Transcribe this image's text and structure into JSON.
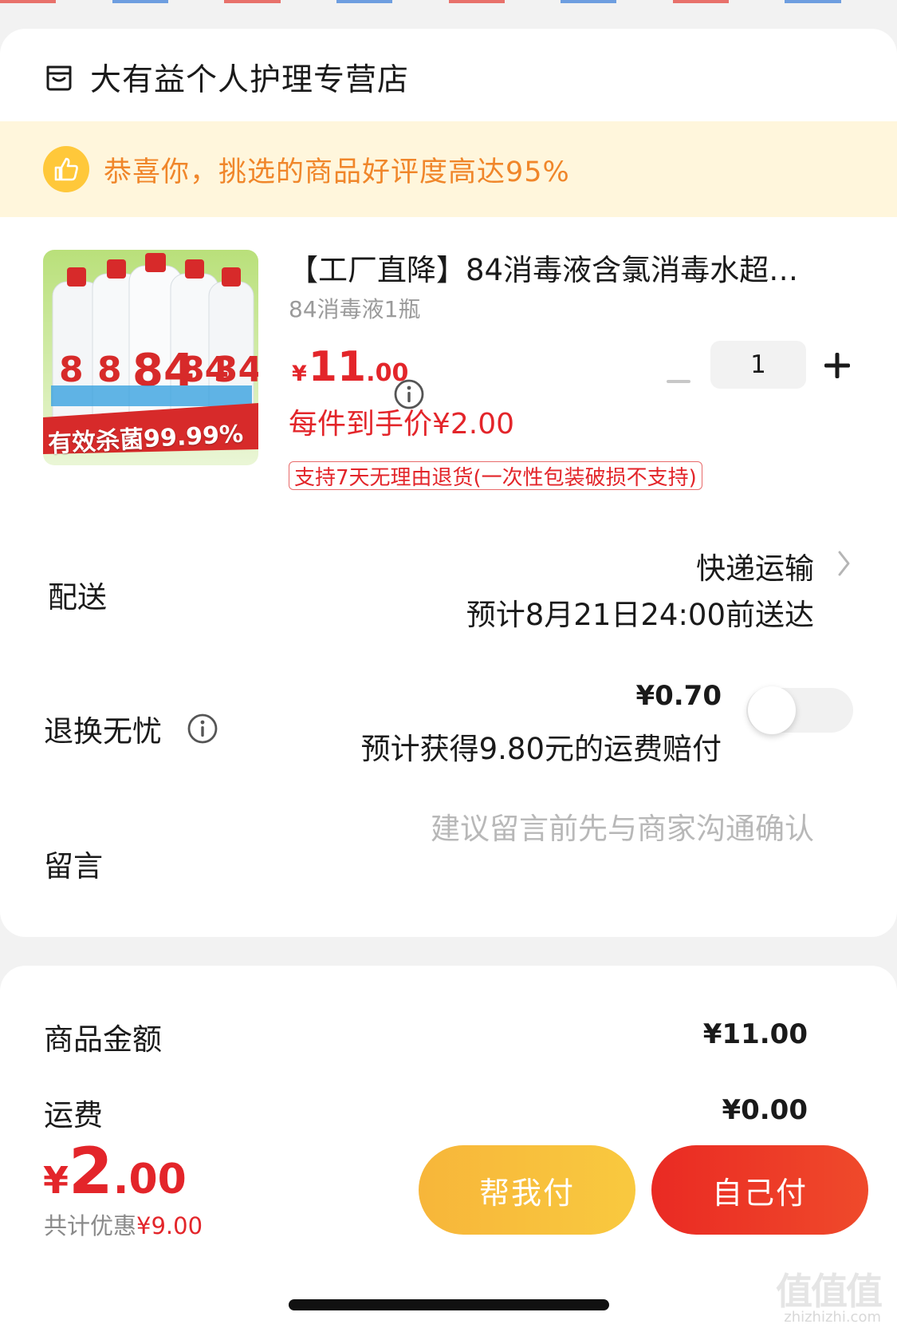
{
  "colors": {
    "accent": "#e3252a",
    "banner_bg": "#fff6dc",
    "banner_text": "#f0862a",
    "pay_help": "#f7b63a",
    "pay_self": "#ea2a23"
  },
  "store": {
    "icon": "store-icon",
    "name": "大有益个人护理专营店"
  },
  "banner": {
    "icon": "thumbs-up-icon",
    "text": "恭喜你，挑选的商品好评度高达95%"
  },
  "product": {
    "image_caption": "有效杀菌99.99%",
    "title": "【工厂直降】84消毒液含氯消毒水超…",
    "spec": "84消毒液1瓶",
    "price": {
      "currency": "¥",
      "integer": "11",
      "decimal": ".00"
    },
    "quantity": "1",
    "unit_price": "每件到手价¥2.00",
    "return_policy": "支持7天无理由退货(一次性包装破损不支持)"
  },
  "delivery": {
    "label": "配送",
    "method": "快递运输",
    "eta": "预计8月21日24:00前送达"
  },
  "insurance": {
    "label": "退换无忧",
    "price": "¥0.70",
    "note": "预计获得9.80元的运费赔付",
    "enabled": false
  },
  "message": {
    "label": "留言",
    "placeholder": "建议留言前先与商家沟通确认"
  },
  "summary": {
    "goods_label": "商品金额",
    "goods_value": "¥11.00",
    "shipping_label": "运费",
    "shipping_value": "¥0.00"
  },
  "footer": {
    "total": {
      "currency": "¥",
      "integer": "2",
      "decimal": ".00"
    },
    "discount_label": "共计优惠",
    "discount_value": "¥9.00",
    "help_pay": "帮我付",
    "self_pay": "自己付"
  },
  "watermark": {
    "text": "值值值",
    "domain": "zhizhizhi.com"
  }
}
